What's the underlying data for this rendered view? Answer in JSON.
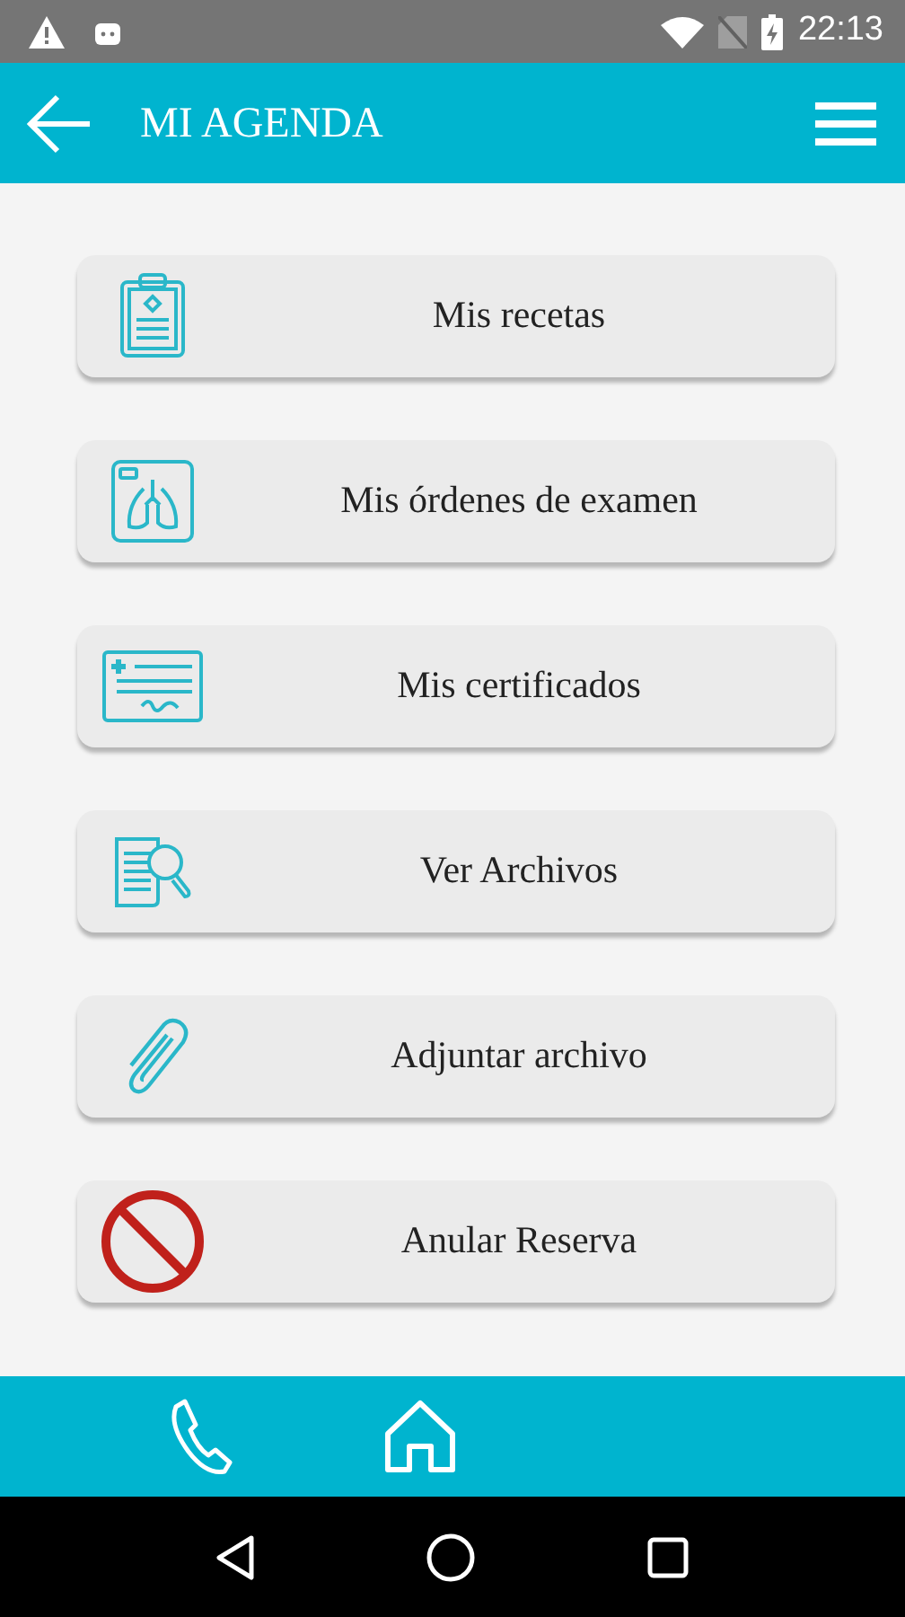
{
  "status_bar": {
    "time": "22:13"
  },
  "app_bar": {
    "title": "MI AGENDA"
  },
  "menu_items": [
    {
      "kind": "prescription",
      "label": "Mis recetas"
    },
    {
      "kind": "xray",
      "label": "Mis órdenes de examen"
    },
    {
      "kind": "certificate",
      "label": "Mis certificados"
    },
    {
      "kind": "search-file",
      "label": "Ver Archivos"
    },
    {
      "kind": "attach",
      "label": "Adjuntar archivo"
    },
    {
      "kind": "cancel",
      "label": "Anular Reserva"
    }
  ]
}
